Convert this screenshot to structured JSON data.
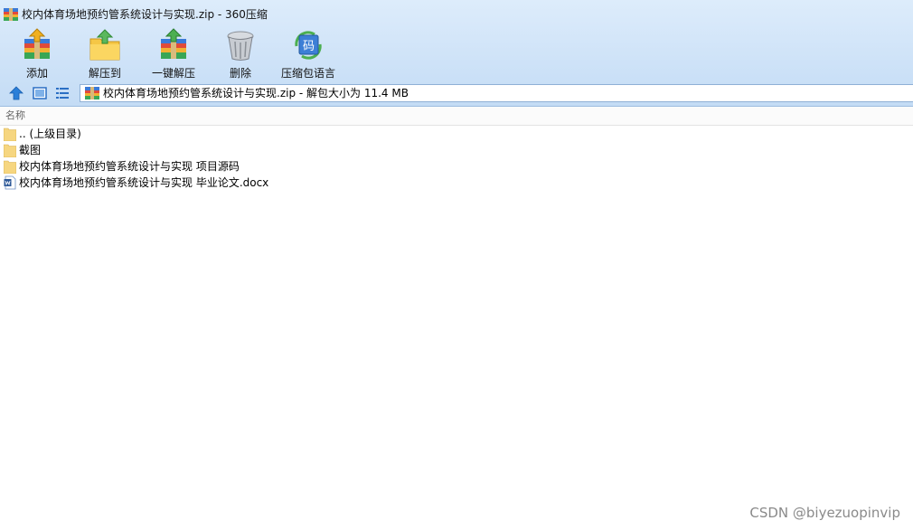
{
  "window": {
    "title": "校内体育场地预约管系统设计与实现.zip - 360压缩"
  },
  "toolbar": {
    "buttons": [
      {
        "label": "添加",
        "icon": "add-archive-icon"
      },
      {
        "label": "解压到",
        "icon": "extract-to-icon"
      },
      {
        "label": "一键解压",
        "icon": "one-click-extract-icon"
      },
      {
        "label": "删除",
        "icon": "trash-bin-icon"
      },
      {
        "label": "压缩包语言",
        "icon": "archive-language-icon",
        "glyph": "码"
      }
    ]
  },
  "nav": {
    "up_icon": "up-arrow-icon",
    "view_icon": "large-icon-view-icon",
    "list_icon": "list-view-icon",
    "address": "校内体育场地预约管系统设计与实现.zip - 解包大小为 11.4 MB"
  },
  "list": {
    "column_name": "名称",
    "items": [
      {
        "name": ".. (上级目录)",
        "icon": "folder-icon"
      },
      {
        "name": "截图",
        "icon": "folder-icon"
      },
      {
        "name": "校内体育场地预约管系统设计与实现 项目源码",
        "icon": "folder-icon"
      },
      {
        "name": "校内体育场地预约管系统设计与实现 毕业论文.docx",
        "icon": "word-document-icon"
      }
    ]
  },
  "watermark": "CSDN @biyezuopinvip",
  "colors": {
    "chrome_top": "#ddecfb",
    "chrome_bottom": "#c4dcf5",
    "folder": "#f6d680",
    "word_blue": "#2b5797",
    "accent_green": "#4caf50"
  }
}
